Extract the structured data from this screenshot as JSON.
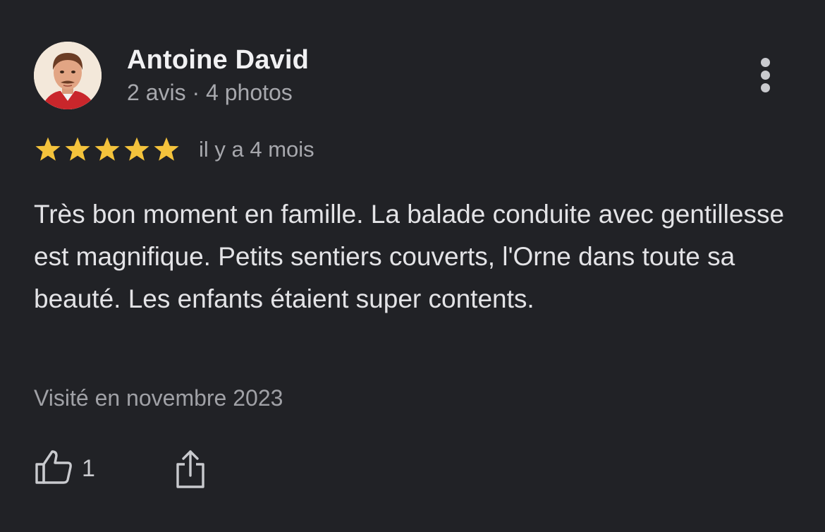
{
  "review": {
    "author": {
      "name": "Antoine David",
      "meta": "2 avis · 4 photos",
      "avatar": "avatar-photo"
    },
    "rating": {
      "stars": 5,
      "max": 5,
      "color": "#f4c33c"
    },
    "relative_date": "il y a 4 mois",
    "text": "Très bon moment en famille. La balade conduite avec gentillesse est magnifique. Petits sentiers couverts, l'Orne dans toute sa beauté. Les enfants étaient super contents.",
    "visit": "Visité en novembre 2023",
    "actions": {
      "like_count": "1",
      "like_icon": "thumbs-up-icon",
      "share_icon": "share-icon",
      "more_icon": "more-vertical-icon"
    }
  },
  "theme": {
    "background": "#212226",
    "primary_text": "#f1f1f3",
    "secondary_text": "#a7a8ad"
  }
}
